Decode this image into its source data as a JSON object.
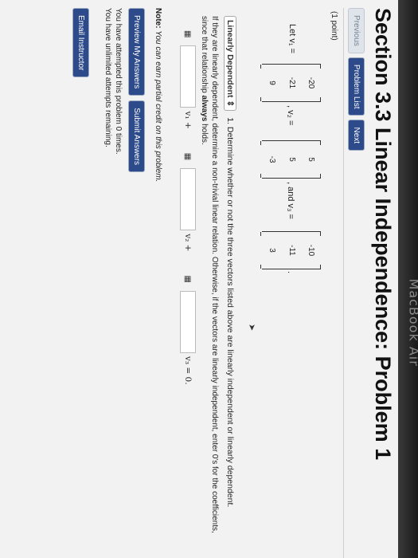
{
  "page": {
    "title": "Section 3.3 Linear Independence: Problem 1",
    "nav": {
      "previous": "Previous",
      "problem_list": "Problem List",
      "next": "Next"
    },
    "points": "(1 point)",
    "let_label": "Let v₁ =",
    "vectors": {
      "v1": [
        "-20",
        "-21",
        "9"
      ],
      "v2": [
        "5",
        "5",
        "-3"
      ],
      "v3": [
        "-10",
        "-11",
        "3"
      ]
    },
    "v2_label": ", v₂ =",
    "v3_label": ", and v₃ =",
    "end_period": ".",
    "question_select": "Linearly Dependent",
    "question_text": "1. Determine whether or not the three vectors listed above are linearly independent or linearly dependent.",
    "instruction_part1": "If they are linearly dependent, determine a non-trivial linear relation. Otherwise, if the vectors are linearly independent, enter 0's for the coefficients, since that relationship",
    "instruction_bold": "always",
    "instruction_part2": "holds.",
    "eq_terms": [
      "v₁ +",
      "v₂ +",
      "v₃ = 0."
    ],
    "note_label": "Note:",
    "note_text": "You can earn partial credit on this problem.",
    "preview_button": "Preview My Answers",
    "submit_button": "Submit Answers",
    "attempts_line1": "You have attempted this problem 0 times.",
    "attempts_line2": "You have unlimited attempts remaining.",
    "email_button": "Email Instructor"
  },
  "device_label": "MacBook Air"
}
